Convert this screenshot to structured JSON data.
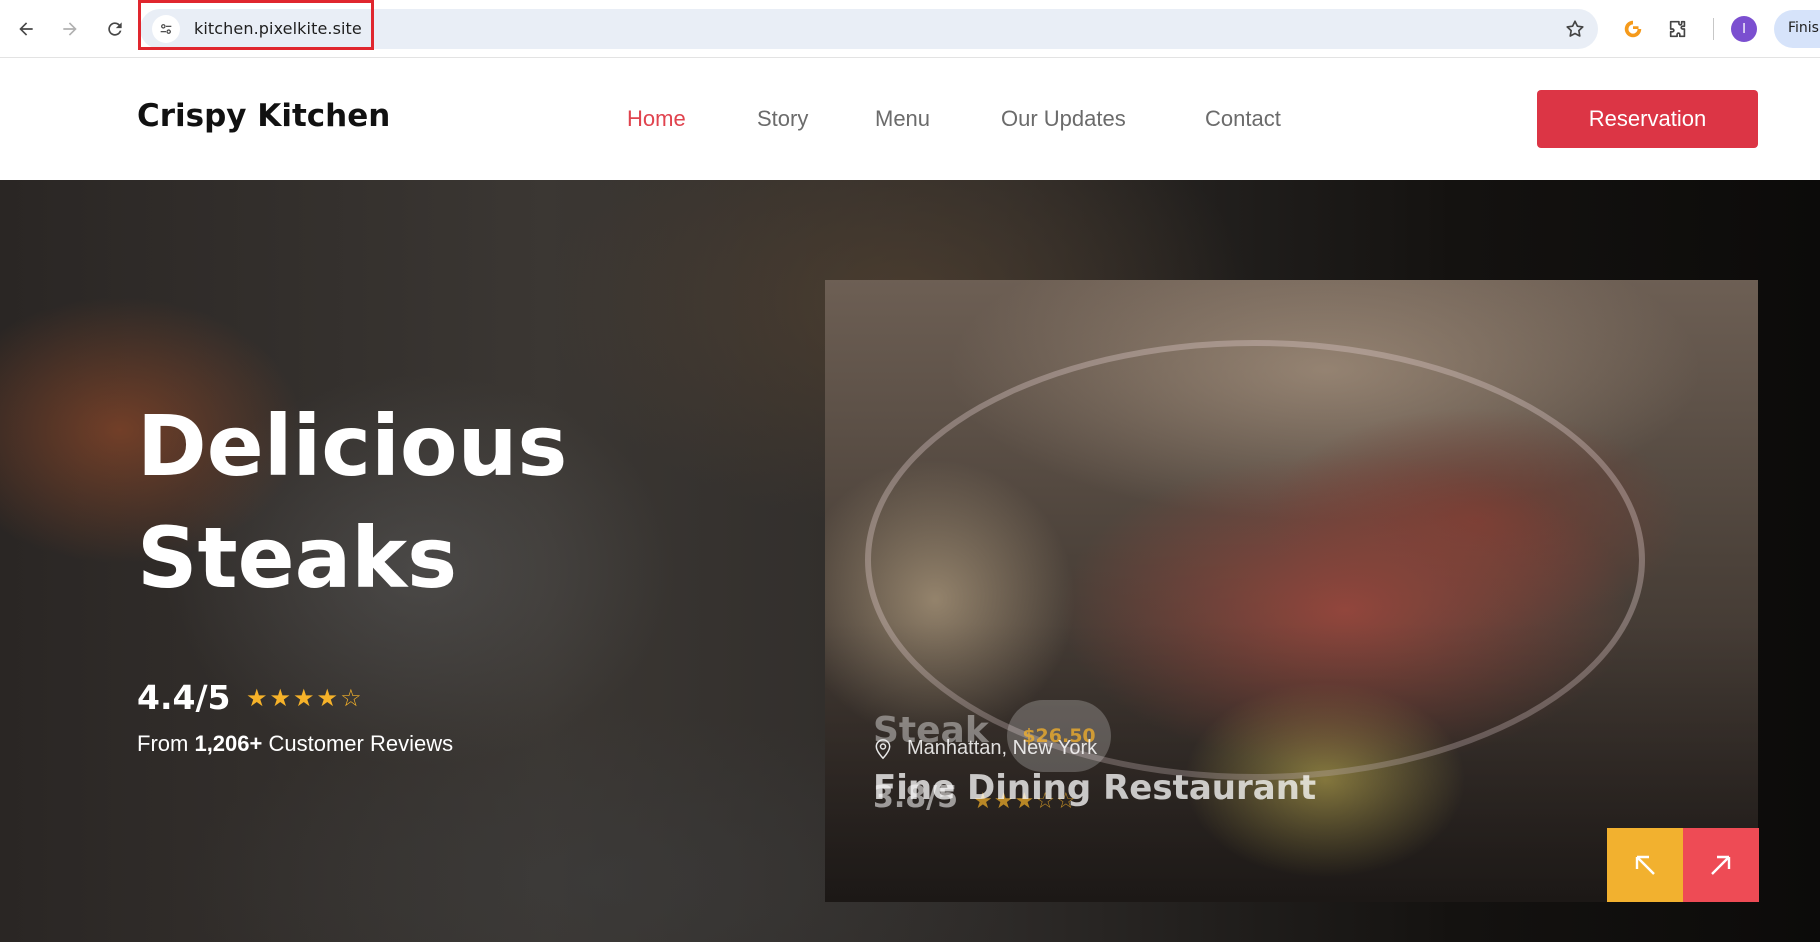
{
  "browser": {
    "url": "kitchen.pixelkite.site",
    "profile_initial": "I",
    "finish_label": "Finish"
  },
  "header": {
    "brand": "Crispy Kitchen",
    "nav": [
      {
        "label": "Home",
        "active": true
      },
      {
        "label": "Story",
        "active": false
      },
      {
        "label": "Menu",
        "active": false
      },
      {
        "label": "Our Updates",
        "active": false
      },
      {
        "label": "Contact",
        "active": false
      }
    ],
    "reserve_label": "Reservation"
  },
  "hero": {
    "title_line1": "Delicious",
    "title_line2": "Steaks",
    "rating": "4.4/5",
    "stars": {
      "filled": 4,
      "total": 5
    },
    "reviews_prefix": "From ",
    "reviews_count": "1,206+",
    "reviews_suffix": " Customer Reviews"
  },
  "feature_card": {
    "ghost_name": "Steak",
    "ghost_price": "$26.50",
    "location": "Manhattan, New York",
    "title": "Fine Dining Restaurant",
    "ghost_rating": "3.8/5",
    "ghost_stars": {
      "filled": 3,
      "total": 5
    }
  },
  "colors": {
    "accent_red": "#dc3545",
    "nav_active": "#e0434e",
    "star_gold": "#f6b229",
    "arrow_prev_bg": "#f2b12f",
    "arrow_next_bg": "#ee4b55"
  }
}
